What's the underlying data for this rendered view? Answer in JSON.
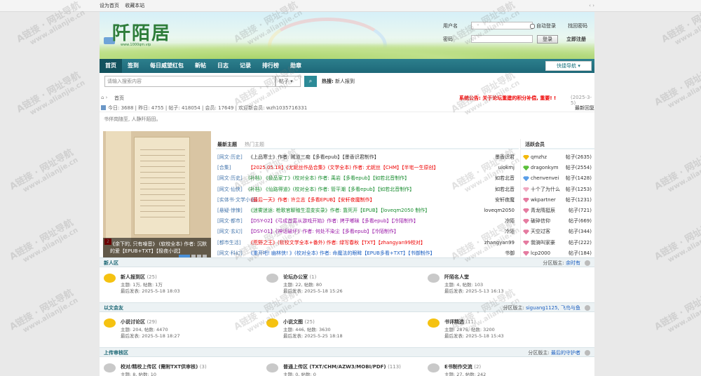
{
  "topbar": {
    "set_home": "设为首页",
    "bookmark": "收藏本站",
    "arrows": "‹ ›"
  },
  "logo": {
    "text": "阡陌居",
    "sub": "www.1000qm.vip"
  },
  "login": {
    "username_label": "用户名",
    "password_label": "密码",
    "auto_login": "自动登录",
    "retrieve": "找回密码",
    "login_btn": "登录",
    "register": "立即注册"
  },
  "nav": {
    "items": [
      "首页",
      "签到",
      "每日威望红包",
      "新帖",
      "日志",
      "记录",
      "排行榜",
      "勋章"
    ],
    "quick": "快捷导航 ▾"
  },
  "search": {
    "placeholder": "请输入搜索内容",
    "type": "帖子 ▾",
    "hot_label": "热搜:",
    "hot_term": "新人报到"
  },
  "breadcrumb": {
    "home": "⌂ ›",
    "current": "首页",
    "notice": "系统公告: 关于论坛重建的积分补偿, 重要! !",
    "notice_date": "(2025-3-5)"
  },
  "stats": {
    "text": "今日: 3688 | 昨日: 4755 | 帖子: 418054 | 会员: 17649 | 欢迎新会员: wzh1035716331",
    "latest": "最新回复"
  },
  "slogan": "书伴岗随至, 人静阡陌田。",
  "slider": {
    "caption": "《余下的, 只有噪音》 (软校全本) 作者: 沉默的爱【EPUB+TXT】【极夜小说】",
    "index": "2"
  },
  "tabs": {
    "latest": "最新主题",
    "hot": "热门主题",
    "active": "活跃会员"
  },
  "threads": [
    {
      "cat": "[网文·历史]",
      "title": "《上品寒士》作者: 贼道三痴【多看epub】【墨香识君制作】",
      "author": "墨香识君",
      "color": ""
    },
    {
      "cat": "[合集]",
      "title": "【2025.05.18】《尤妮丝作品合集》(文学全本) 作者: 尤妮丝【CHM】【半宅一生原创】",
      "author": "uiokmj",
      "color": "c-red"
    },
    {
      "cat": "[网文·历史]",
      "title": "(补档) 《极品家丁》(校对全本) 作者: 禹岩【多看epub】【如若北音制作】",
      "author": "如若北音",
      "color": "c-green"
    },
    {
      "cat": "[网文·仙侠]",
      "title": "(补档) 《仙路得道》(校对全本) 作者: 管平潮【多看epub】【如若北音制作】",
      "author": "如若北音",
      "color": "c-green"
    },
    {
      "cat": "[实体书·文学小说]",
      "title": "《最后一天》作者: 许立志【多看EPUB】【安轩夜魔制作】",
      "author": "安轩夜魔",
      "color": "c-red"
    },
    {
      "cat": "[悬疑·惊悚]",
      "title": "《迷雾迷途: 枪歌官聊殖生混变实录》作者: 靠死开【EPUB】【loveqm2050 制作】",
      "author": "loveqm2050",
      "color": "c-green"
    },
    {
      "cat": "[网文·都市]",
      "title": "【DSY-02】《弓成首富从游戏开始》作者: 拷乎嘟昧【多看epub】【冷陌制作】",
      "author": "冷陌",
      "color": "c-purple"
    },
    {
      "cat": "[网文·玄幻]",
      "title": "【DSY-01】《神话破坏》作者: 何处不染尘【多看epub】【冷陌制作】",
      "author": "冷陌",
      "color": "c-purple"
    },
    {
      "cat": "[都市生活]",
      "title": "《荒野之王》(软校文学全本+番外) 作者: 绿写春秋【TXT】【zhangyan99校对】",
      "author": "zhangyan99",
      "color": "c-red"
    },
    {
      "cat": "[网文·科幻]",
      "title": "《重开吧! 幽林侠! 》(校对全本) 作者: 命魔法的眼眸【EPUB多看+TXT】【书御制作】",
      "author": "书御",
      "color": "c-blue"
    }
  ],
  "active_members": [
    {
      "name": "qmzhz",
      "count": "帖子(2635)",
      "medal": "#f3b90b"
    },
    {
      "name": "dragonkym",
      "count": "帖子(2554)",
      "medal": "#5bbf3a"
    },
    {
      "name": "chenvenvei",
      "count": "帖子(1428)",
      "medal": "#5a9ee8"
    },
    {
      "name": "十个了为什么",
      "count": "帖子(1253)",
      "medal": "#f0a8c0"
    },
    {
      "name": "wkpartner",
      "count": "帖子(1231)",
      "medal": "#e57ba0"
    },
    {
      "name": "青龙隋挺辰",
      "count": "帖子(721)",
      "medal": "#e57ba0"
    },
    {
      "name": "破碎信仰",
      "count": "帖子(669)",
      "medal": "#e57ba0"
    },
    {
      "name": "天空过客",
      "count": "帖子(344)",
      "medal": "#e57ba0"
    },
    {
      "name": "我骑叫家豪",
      "count": "帖子(222)",
      "medal": "#e57ba0"
    },
    {
      "name": "lcp2000",
      "count": "帖子(184)",
      "medal": "#e57ba0"
    }
  ],
  "sections": [
    {
      "name": "新人区",
      "mods_label": "分区版主:",
      "mods": "余时有",
      "forums": [
        {
          "name": "新人报到区",
          "count": "(25)",
          "line1": "主题: 1万, 帖数: 1万",
          "line2": "最后发表: 2025-5-18 18:03",
          "bubble": "yellow"
        },
        {
          "name": "论坛办公室",
          "count": "(1)",
          "line1": "主题: 22, 帖数: 80",
          "line2": "最后发表: 2025-5-18 15:26",
          "bubble": "gray"
        },
        {
          "name": "阡陌名人堂",
          "count": "",
          "line1": "主题: 4, 帖数: 103",
          "line2": "最后发表: 2025-5-13 16:13",
          "bubble": "gray"
        }
      ]
    },
    {
      "name": "以文会友",
      "mods_label": "分区版主:",
      "mods": "siguang1125, 飞鸟与鱼",
      "forums": [
        {
          "name": "小说讨论区",
          "count": "(29)",
          "line1": "主题: 204, 帖数: 4470",
          "line2": "最后发表: 2025-5-18 18:27",
          "bubble": "yellow"
        },
        {
          "name": "小说文图",
          "count": "(25)",
          "line1": "主题: 446, 帖数: 3630",
          "line2": "最后发表: 2025-5-25 18:18",
          "bubble": "yellow"
        },
        {
          "name": "书评精选",
          "count": "(11)",
          "line1": "主题: 2875, 帖数: 3200",
          "line2": "最后发表: 2025-5-18 15:43",
          "bubble": "yellow"
        }
      ]
    },
    {
      "name": "上传审核区",
      "mods_label": "分区版主:",
      "mods": "最后的守护者",
      "forums": [
        {
          "name": "校对/精校上传区 (需附TXT供审核)",
          "count": "(3)",
          "line1": "主题: 8, 帖数: 10",
          "line2": "",
          "bubble": "gray"
        },
        {
          "name": "普通上传区 (TXT/CHM/AZW3/MOBI/PDF)",
          "count": "(113)",
          "line1": "主题: 0, 帖数: 0",
          "line2": "",
          "bubble": "gray"
        },
        {
          "name": "E书制作交流",
          "count": "(2)",
          "line1": "主题: 27, 帖数: 242",
          "line2": "",
          "bubble": "gray"
        }
      ]
    }
  ],
  "watermark": {
    "text": "A链接 · 网址导航",
    "url": "www.alianjie.cn"
  },
  "colors": {
    "nav": "#1e6878",
    "accent": "#2c8a97",
    "notice": "#e00000",
    "section_header": "#ecf2f4"
  }
}
